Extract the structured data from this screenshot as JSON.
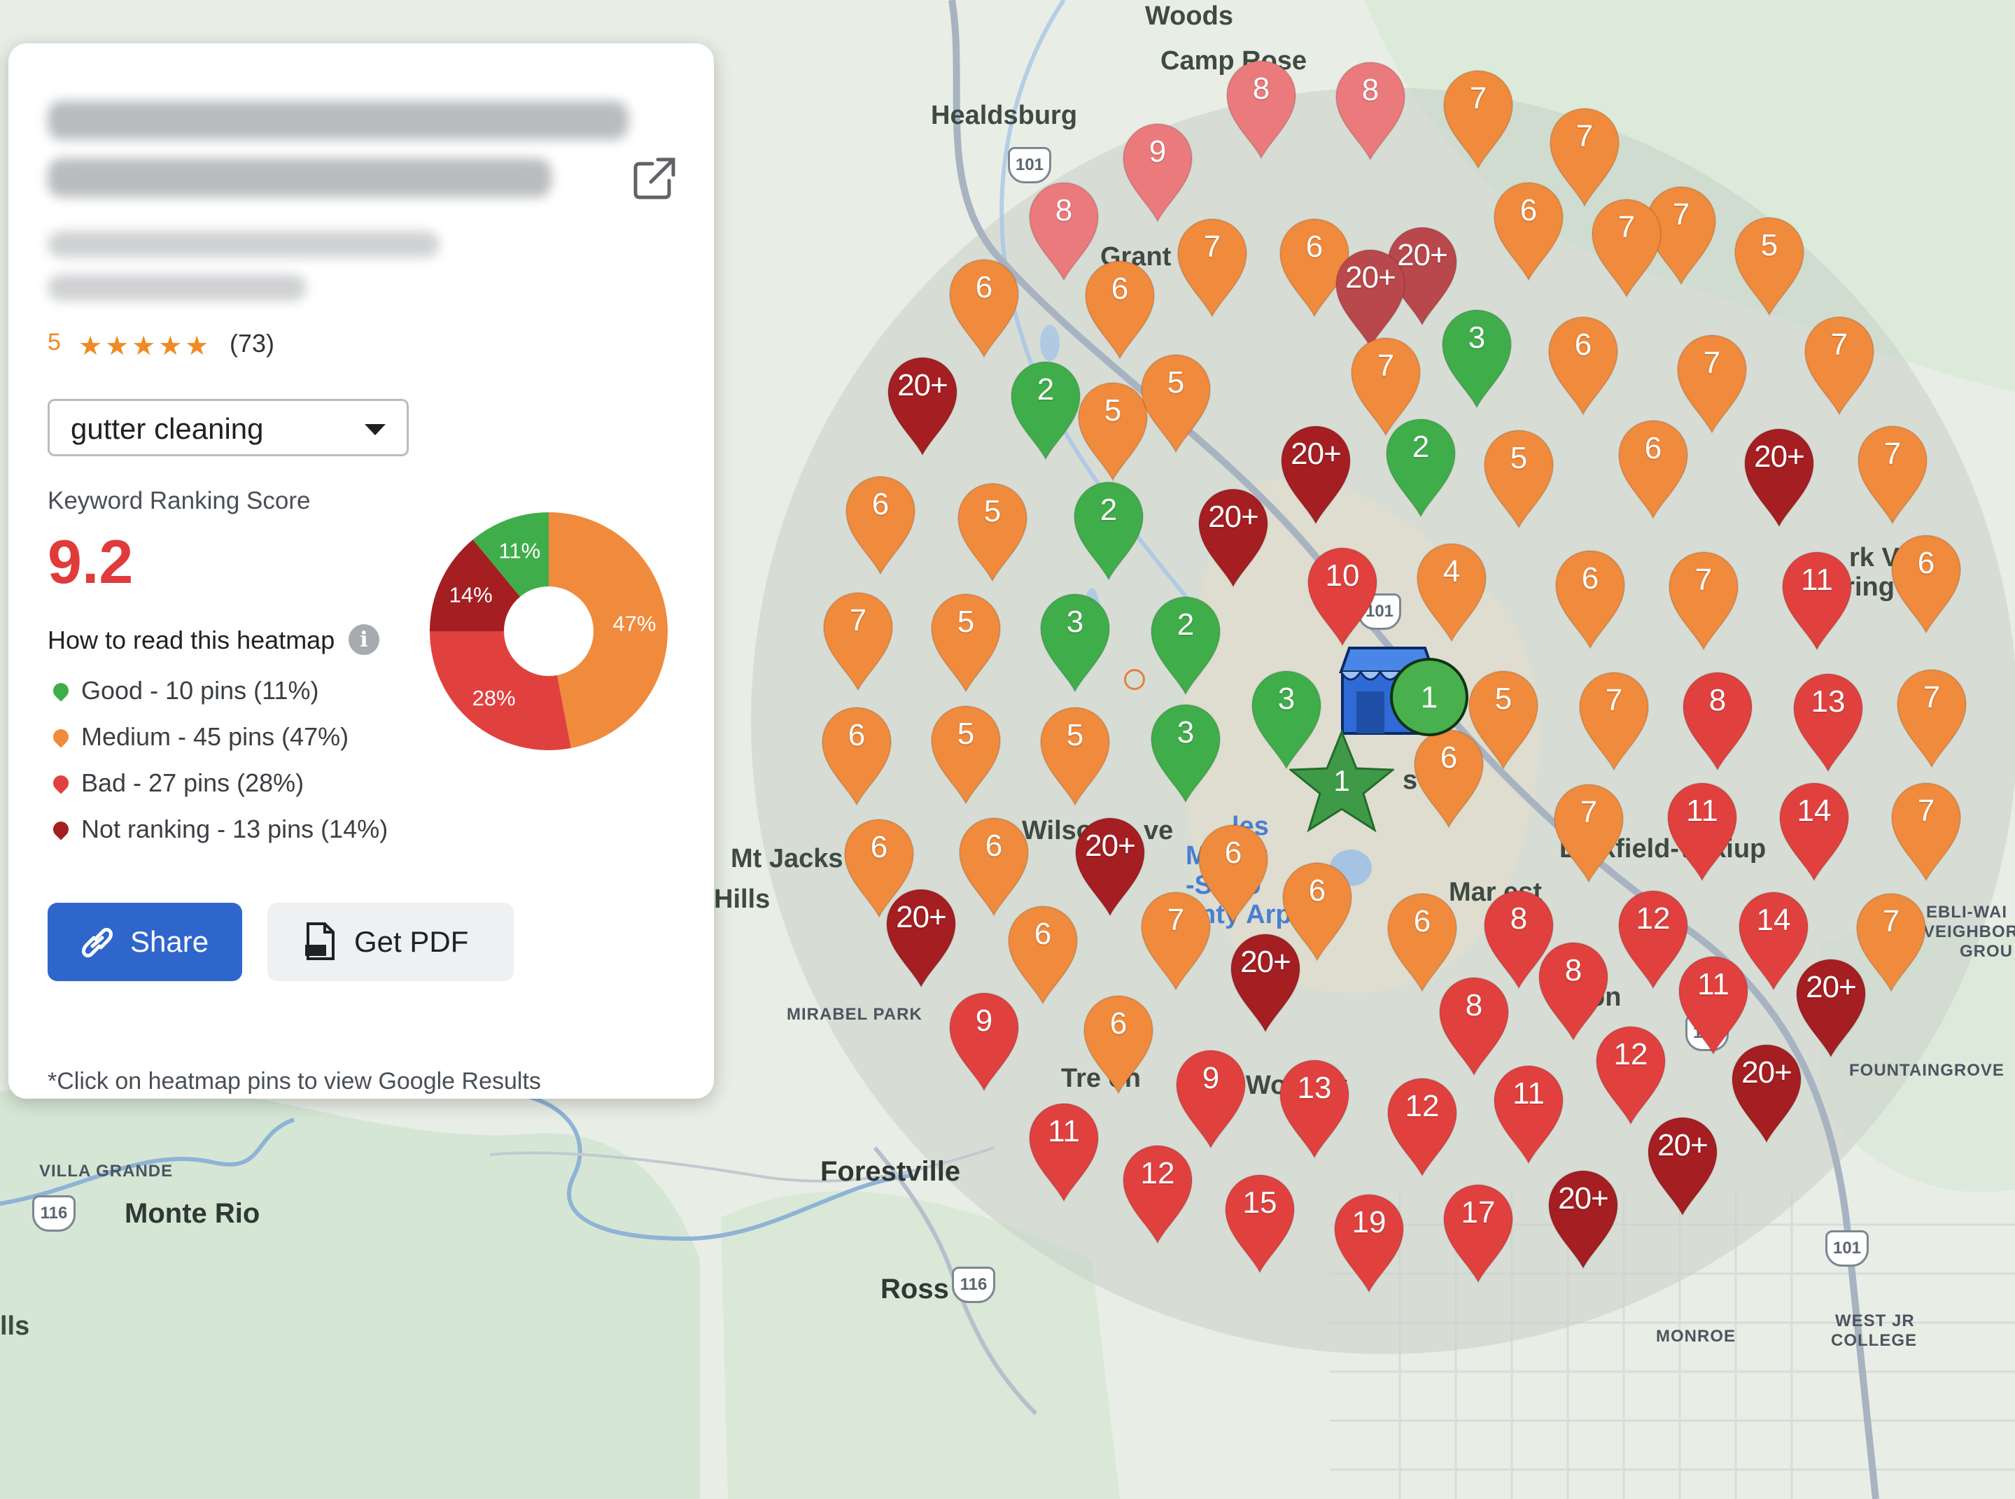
{
  "business": {
    "name_line1": "",
    "name_line2": "",
    "address_line1": "",
    "address_line2": "",
    "rating_value": "5",
    "stars": "★★★★★",
    "review_count": "(73)"
  },
  "keyword_select": {
    "value": "gutter cleaning"
  },
  "score": {
    "label": "Keyword Ranking Score",
    "value": "9.2"
  },
  "howto_label": "How to read this heatmap",
  "legend": [
    {
      "text": "Good - 10 pins (11%)",
      "color": "#3fae4a"
    },
    {
      "text": "Medium - 45 pins (47%)",
      "color": "#f08a3c"
    },
    {
      "text": "Bad - 27 pins (28%)",
      "color": "#e0413f"
    },
    {
      "text": "Not ranking - 13 pins (14%)",
      "color": "#a41e22"
    }
  ],
  "donut": [
    {
      "label": "47%",
      "value": 47,
      "color": "#f08a3c"
    },
    {
      "label": "28%",
      "value": 28,
      "color": "#e0413f"
    },
    {
      "label": "14%",
      "value": 14,
      "color": "#a41e22"
    },
    {
      "label": "11%",
      "value": 11,
      "color": "#3fae4a"
    }
  ],
  "buttons": {
    "share": "Share",
    "pdf": "Get PDF"
  },
  "footnote": "*Click on heatmap pins to view Google Results",
  "center": {
    "business_rank": "1",
    "star_rank": "1"
  },
  "places": {
    "woods": "Woods",
    "camp_rose": "Camp Rose",
    "healdsburg": "Healdsburg",
    "grant": "Grant",
    "mt_jackson": "Mt Jacks",
    "hills": "Hills",
    "wilson": "Wilso",
    "ve": "ve",
    "charles": "les",
    "mschulz": "M    hulz",
    "sonoma": "-Sono",
    "airport": "nty Arp",
    "larkfield": "Larkfield-Wikiup",
    "mark_west": "Mar    est",
    "fulton": "on",
    "pring": "pring",
    "rk_v": "rk V",
    "mirabel": "MIRABEL PARK",
    "trenton": "Tre   on",
    "woolsey": "Wool   ey",
    "forestville": "Forestville",
    "villa_grande": "VILLA GRANDE",
    "monte_rio": "Monte Rio",
    "ross": "Ross",
    "monroe": "MONROE",
    "west_jr": "WEST JR",
    "college": "COLLEGE",
    "fountaingrove": "FOUNTAINGROVE",
    "ebli": "EBLI-WAI",
    "neighbor": "VEIGHBOR",
    "group": "GROU",
    "s": "s",
    "lls": "lls"
  },
  "highways": {
    "h101": "101",
    "h116": "116"
  },
  "colors": {
    "good": "#3fae4a",
    "medium": "#f08a3c",
    "bad": "#e0413f",
    "not_ranking": "#a41e22",
    "accent": "#2f66cc",
    "score": "#e03a3a"
  },
  "pins": [
    {
      "label": "8",
      "cat": "bad_light"
    },
    {
      "label": "8",
      "cat": "bad_light"
    },
    {
      "label": "7",
      "cat": "medium"
    },
    {
      "label": "7",
      "cat": "medium"
    },
    {
      "label": "9",
      "cat": "bad_light"
    },
    {
      "label": "8",
      "cat": "bad_light"
    },
    {
      "label": "7",
      "cat": "medium"
    },
    {
      "label": "6",
      "cat": "medium"
    },
    {
      "label": "20+",
      "cat": "not_ranking_light"
    },
    {
      "label": "6",
      "cat": "medium"
    },
    {
      "label": "7",
      "cat": "medium"
    },
    {
      "label": "6",
      "cat": "medium"
    },
    {
      "label": "6",
      "cat": "medium"
    },
    {
      "label": "20+",
      "cat": "not_ranking_light"
    },
    {
      "label": "7",
      "cat": "medium"
    },
    {
      "label": "5",
      "cat": "medium"
    },
    {
      "label": "3",
      "cat": "good"
    },
    {
      "label": "6",
      "cat": "medium"
    },
    {
      "label": "7",
      "cat": "medium"
    },
    {
      "label": "7",
      "cat": "medium"
    },
    {
      "label": "7",
      "cat": "medium"
    },
    {
      "label": "5",
      "cat": "medium"
    },
    {
      "label": "5",
      "cat": "medium"
    },
    {
      "label": "20+",
      "cat": "not_ranking"
    },
    {
      "label": "2",
      "cat": "good"
    },
    {
      "label": "20+",
      "cat": "not_ranking"
    },
    {
      "label": "2",
      "cat": "good"
    },
    {
      "label": "5",
      "cat": "medium"
    },
    {
      "label": "6",
      "cat": "medium"
    },
    {
      "label": "20+",
      "cat": "not_ranking"
    },
    {
      "label": "7",
      "cat": "medium"
    },
    {
      "label": "6",
      "cat": "medium"
    },
    {
      "label": "5",
      "cat": "medium"
    },
    {
      "label": "2",
      "cat": "good"
    },
    {
      "label": "20+",
      "cat": "not_ranking"
    },
    {
      "label": "10",
      "cat": "bad"
    },
    {
      "label": "4",
      "cat": "medium"
    },
    {
      "label": "6",
      "cat": "medium"
    },
    {
      "label": "7",
      "cat": "medium"
    },
    {
      "label": "11",
      "cat": "bad"
    },
    {
      "label": "6",
      "cat": "medium"
    },
    {
      "label": "7",
      "cat": "medium"
    },
    {
      "label": "5",
      "cat": "medium"
    },
    {
      "label": "3",
      "cat": "good"
    },
    {
      "label": "2",
      "cat": "good"
    },
    {
      "label": "3",
      "cat": "good"
    },
    {
      "label": "5",
      "cat": "medium"
    },
    {
      "label": "7",
      "cat": "medium"
    },
    {
      "label": "8",
      "cat": "bad"
    },
    {
      "label": "13",
      "cat": "bad"
    },
    {
      "label": "7",
      "cat": "medium"
    },
    {
      "label": "6",
      "cat": "medium"
    },
    {
      "label": "5",
      "cat": "medium"
    },
    {
      "label": "5",
      "cat": "medium"
    },
    {
      "label": "3",
      "cat": "good"
    },
    {
      "label": "6",
      "cat": "medium"
    },
    {
      "label": "7",
      "cat": "medium"
    },
    {
      "label": "11",
      "cat": "bad"
    },
    {
      "label": "14",
      "cat": "bad"
    },
    {
      "label": "7",
      "cat": "medium"
    },
    {
      "label": "6",
      "cat": "medium"
    },
    {
      "label": "6",
      "cat": "medium"
    },
    {
      "label": "20+",
      "cat": "not_ranking"
    },
    {
      "label": "6",
      "cat": "medium"
    },
    {
      "label": "6",
      "cat": "medium"
    },
    {
      "label": "6",
      "cat": "medium"
    },
    {
      "label": "8",
      "cat": "bad"
    },
    {
      "label": "12",
      "cat": "bad"
    },
    {
      "label": "14",
      "cat": "bad"
    },
    {
      "label": "7",
      "cat": "medium"
    },
    {
      "label": "20+",
      "cat": "not_ranking"
    },
    {
      "label": "6",
      "cat": "medium"
    },
    {
      "label": "7",
      "cat": "medium"
    },
    {
      "label": "20+",
      "cat": "not_ranking"
    },
    {
      "label": "8",
      "cat": "bad"
    },
    {
      "label": "8",
      "cat": "bad"
    },
    {
      "label": "11",
      "cat": "bad"
    },
    {
      "label": "20+",
      "cat": "not_ranking"
    },
    {
      "label": "9",
      "cat": "bad"
    },
    {
      "label": "6",
      "cat": "medium"
    },
    {
      "label": "9",
      "cat": "bad"
    },
    {
      "label": "13",
      "cat": "bad"
    },
    {
      "label": "12",
      "cat": "bad"
    },
    {
      "label": "11",
      "cat": "bad"
    },
    {
      "label": "12",
      "cat": "bad"
    },
    {
      "label": "20+",
      "cat": "not_ranking"
    },
    {
      "label": "11",
      "cat": "bad"
    },
    {
      "label": "12",
      "cat": "bad"
    },
    {
      "label": "20+",
      "cat": "not_ranking"
    },
    {
      "label": "15",
      "cat": "bad"
    },
    {
      "label": "19",
      "cat": "bad"
    },
    {
      "label": "17",
      "cat": "bad"
    },
    {
      "label": "20+",
      "cat": "not_ranking"
    }
  ]
}
